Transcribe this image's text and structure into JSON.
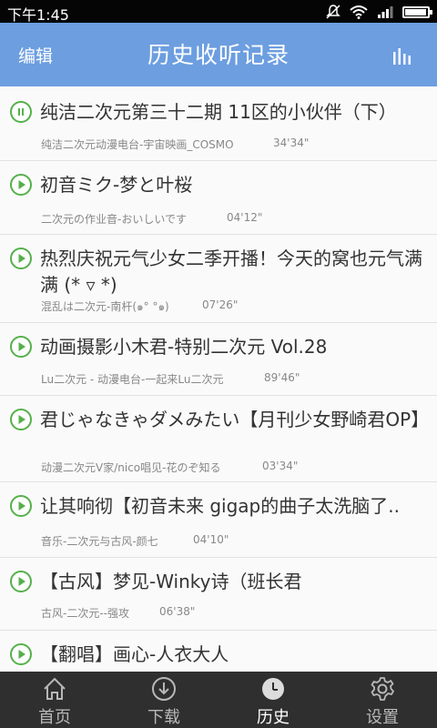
{
  "status_bar": {
    "time": "下午1:45",
    "battery_level": 0.95
  },
  "header": {
    "edit_label": "编辑",
    "title": "历史收听记录"
  },
  "items": [
    {
      "title": "纯洁二次元第三十二期 11区的小伙伴（下）",
      "subtitle": "纯洁二次元动漫电台-宇宙映画_COSMO",
      "duration": "34'34\"",
      "state": "paused"
    },
    {
      "title": "初音ミク-梦と叶桜",
      "subtitle": "二次元の作业音-おいしいです",
      "duration": "04'12\"",
      "state": "play"
    },
    {
      "title": "热烈庆祝元气少女二季开播！今天的窝也元气满满 (* ▿ *)",
      "subtitle": "混乱は二次元-南杆(๑° °๑)",
      "duration": "07'26\"",
      "state": "play"
    },
    {
      "title": "动画摄影小木君-特别二次元 Vol.28",
      "subtitle": "Lu二次元 - 动漫电台-一起来Lu二次元",
      "duration": "89'46\"",
      "state": "play"
    },
    {
      "title": "君じゃなきゃダメみたい【月刊少女野崎君OP】",
      "subtitle": "动漫二次元V家/nico唱见-花のぞ知る",
      "duration": "03'34\"",
      "state": "play"
    },
    {
      "title": "让其响彻【初音未来 gigap的曲子太洗脑了..",
      "subtitle": "音乐-二次元与古风-颜七",
      "duration": "04'10\"",
      "state": "play"
    },
    {
      "title": "【古风】梦见-Winky诗（班长君",
      "subtitle": "古风-二次元--强攻",
      "duration": "06'38\"",
      "state": "play"
    },
    {
      "title": "【翻唱】画心-人衣大人",
      "subtitle": "",
      "duration": "",
      "state": "play"
    }
  ],
  "tabs": [
    {
      "label": "首页",
      "icon": "home-icon"
    },
    {
      "label": "下载",
      "icon": "download-icon"
    },
    {
      "label": "历史",
      "icon": "clock-icon",
      "active": true
    },
    {
      "label": "设置",
      "icon": "gear-icon"
    }
  ],
  "colors": {
    "header": "#6c9ee0",
    "accent_green": "#55b04a",
    "tabbar": "#2f2f2f"
  }
}
